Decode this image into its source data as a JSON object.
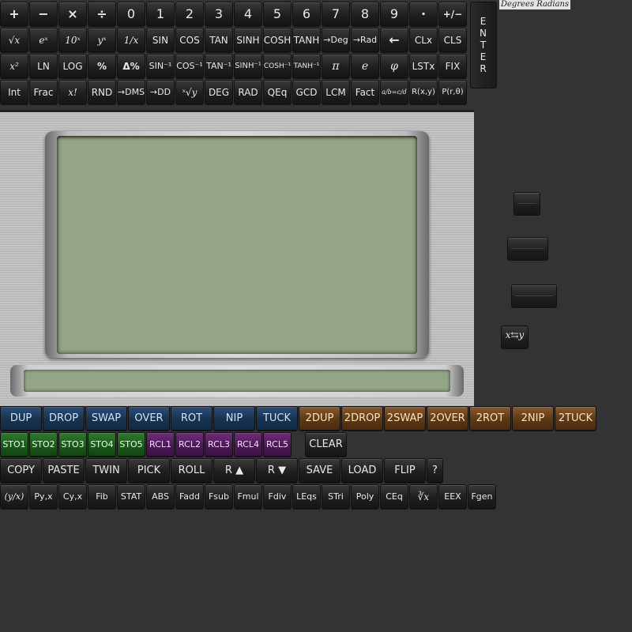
{
  "mode_label": "Degrees Radians",
  "enter_letters": [
    "E",
    "N",
    "T",
    "E",
    "R"
  ],
  "rows": {
    "r1": [
      "+",
      "−",
      "×",
      "÷",
      "0",
      "1",
      "2",
      "3",
      "4",
      "5",
      "6",
      "7",
      "8",
      "9",
      "·",
      "+/−"
    ],
    "r2": [
      "√x",
      "eˣ",
      "10ˣ",
      "yˣ",
      "1/x",
      "SIN",
      "COS",
      "TAN",
      "SINH",
      "COSH",
      "TANH",
      "→Deg",
      "→Rad",
      "←",
      "CLx",
      "CLS"
    ],
    "r3": [
      "x²",
      "LN",
      "LOG",
      "%",
      "Δ%",
      "SIN⁻¹",
      "COS⁻¹",
      "TAN⁻¹",
      "SINH⁻¹",
      "COSH⁻¹",
      "TANH⁻¹",
      "π",
      "e",
      "φ",
      "LSTx",
      "FIX"
    ],
    "r4": [
      "Int",
      "Frac",
      "x!",
      "RND",
      "→DMS",
      "→DD",
      "ˣ√y",
      "DEG",
      "RAD",
      "QEq",
      "GCD",
      "LCM",
      "Fact",
      "a/b=c/d",
      "R(x,y)",
      "P(r,θ)"
    ],
    "stack": [
      "DUP",
      "DROP",
      "SWAP",
      "OVER",
      "ROT",
      "NIP",
      "TUCK",
      "2DUP",
      "2DROP",
      "2SWAP",
      "2OVER",
      "2ROT",
      "2NIP",
      "2TUCK"
    ],
    "memory": [
      "STO1",
      "STO2",
      "STO3",
      "STO4",
      "STO5",
      "RCL1",
      "RCL2",
      "RCL3",
      "RCL4",
      "RCL5",
      "CLEAR"
    ],
    "edit": [
      "COPY",
      "PASTE",
      "TWIN",
      "PICK",
      "ROLL",
      "R ▲",
      "R ▼",
      "SAVE",
      "LOAD",
      "FLIP",
      "?"
    ],
    "funcs": [
      "(y/x)",
      "Py,x",
      "Cy,x",
      "Fib",
      "STAT",
      "ABS",
      "Fadd",
      "Fsub",
      "Fmul",
      "Fdiv",
      "LEqs",
      "STri",
      "Poly",
      "CEq",
      "∛x",
      "EEX",
      "Fgen"
    ]
  },
  "side": {
    "xy_swap": "x⇆y"
  },
  "colors": {
    "blue": "#1d3d60",
    "orange": "#6b4420",
    "green": "#1f621f",
    "purple": "#571f62",
    "lcd": "#93a585"
  }
}
